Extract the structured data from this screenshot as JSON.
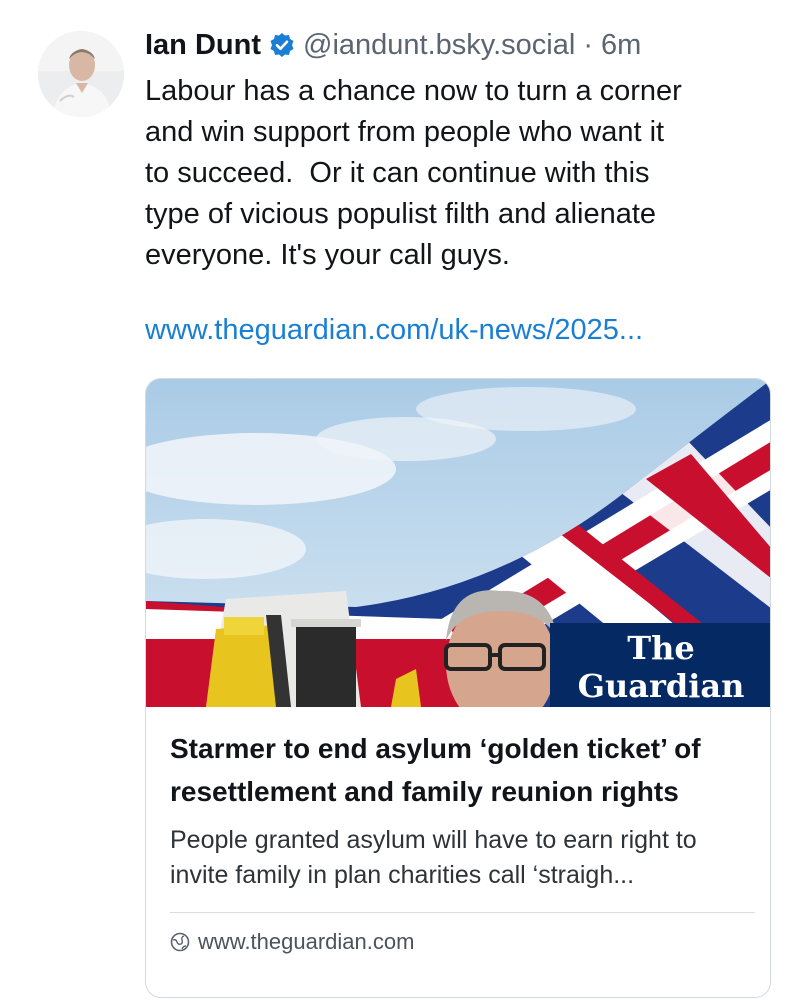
{
  "post": {
    "author_name": "Ian Dunt",
    "handle": "@iandunt.bsky.social",
    "separator": "·",
    "time": "6m",
    "text": "Labour has a chance now to turn a corner\nand win support from people who want it\nto succeed.  Or it can continue with this\ntype of vicious populist filth and alienate\neveryone. It's your call guys.",
    "link_text": "www.theguardian.com/uk-news/2025..."
  },
  "card": {
    "logo_line1": "The",
    "logo_line2": "Guardian",
    "title": "Starmer to end asylum ‘golden ticket’ of resettlement and family reunion rights",
    "description": "People granted asylum will have to earn right to invite family in plan charities call ‘straigh...",
    "domain": "www.theguardian.com"
  },
  "colors": {
    "link": "#1a7fd4",
    "verified": "#1a7fd4",
    "guardian_blue": "#052962",
    "flag_red": "#c8102e",
    "flag_blue": "#1d3b8b"
  },
  "icons": {
    "verified": "verified-check-icon",
    "globe": "globe-icon"
  }
}
